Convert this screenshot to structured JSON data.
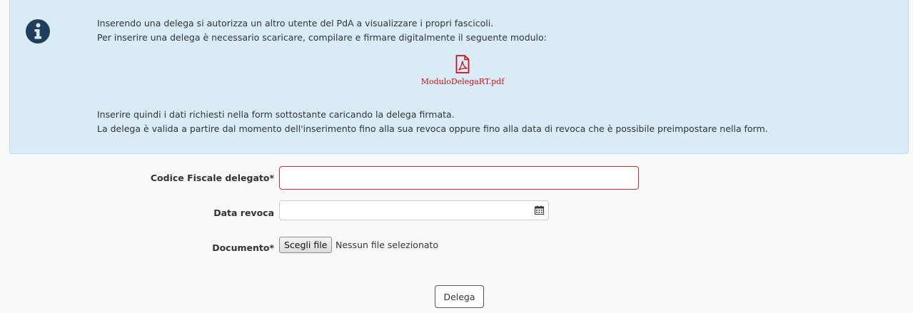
{
  "info": {
    "icon": "info-circle-icon",
    "color": "#d8ebf7",
    "line1": "Inserendo una delega si autorizza un altro utente del PdA a visualizzare i propri fascicoli.",
    "line2": "Per inserire una delega è necessario scaricare, compilare e firmare digitalmente il seguente modulo:",
    "attachment": {
      "icon": "pdf-file-icon",
      "filename": "ModuloDelegaRT.pdf",
      "color": "#cc1111"
    },
    "line3": "Inserire quindi i dati richiesti nella form sottostante caricando la delega firmata.",
    "line4": "La delega è valida a partire dal momento dell'inserimento fino alla sua revoca oppure fino alla data di revoca che è possibile preimpostare nella form."
  },
  "form": {
    "codice_fiscale": {
      "label": "Codice Fiscale delegato*",
      "value": "",
      "error_color": "#c9302c"
    },
    "data_revoca": {
      "label": "Data revoca",
      "value": "",
      "icon": "calendar-icon"
    },
    "documento": {
      "label": "Documento*",
      "button_label": "Scegli file",
      "status": "Nessun file selezionato"
    },
    "submit_label": "Delega"
  }
}
